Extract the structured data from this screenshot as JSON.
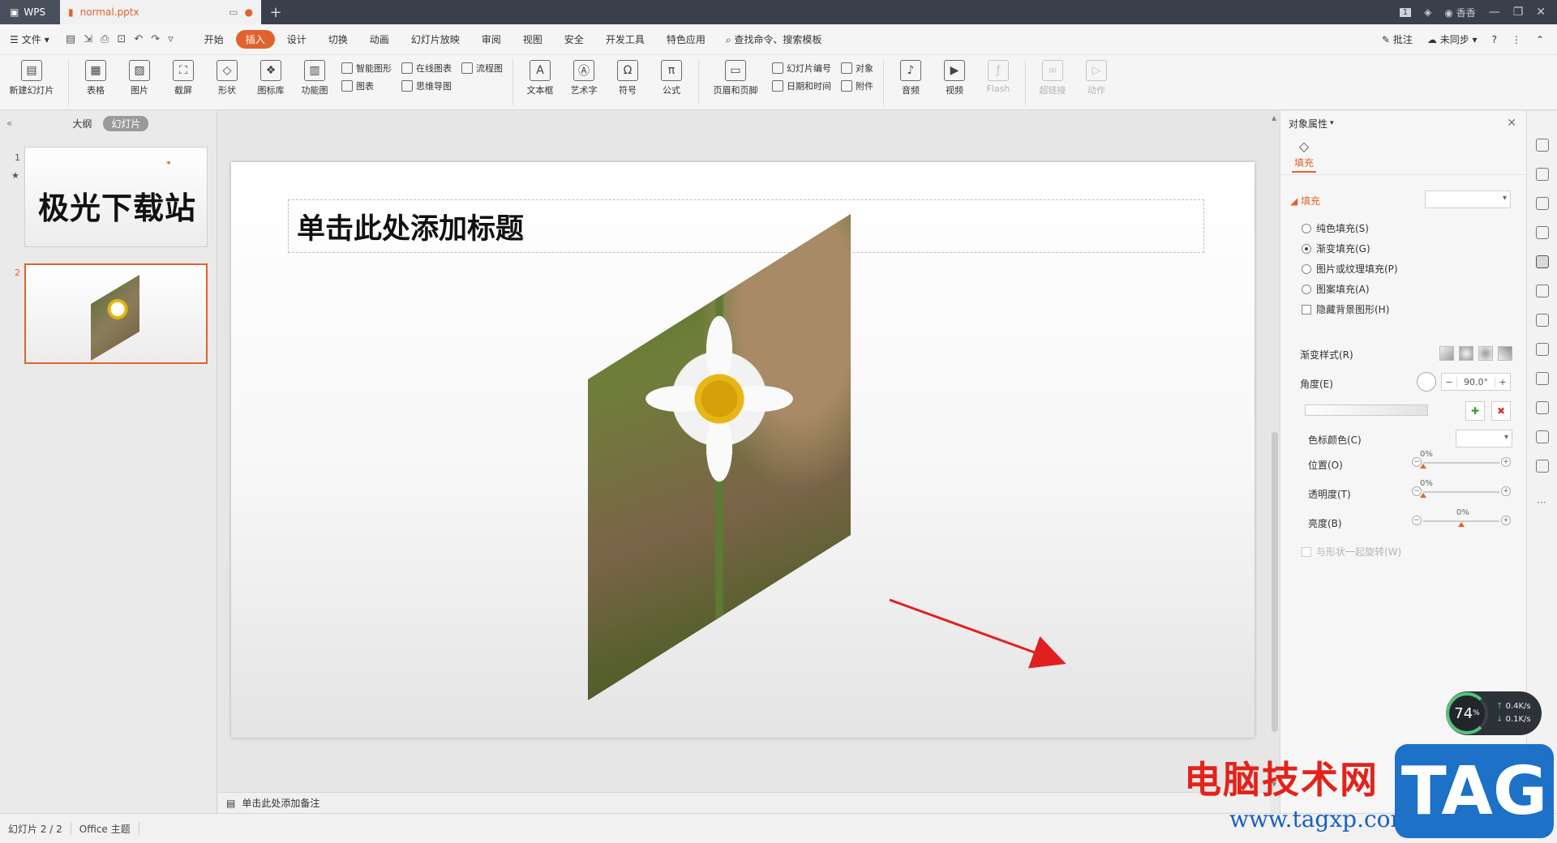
{
  "titlebar": {
    "app_label": "WPS",
    "doc_tab": "normal.pptx",
    "page_indicator": "1",
    "user": "香香"
  },
  "menubar": {
    "file": "文件",
    "items": [
      "开始",
      "插入",
      "设计",
      "切换",
      "动画",
      "幻灯片放映",
      "审阅",
      "视图",
      "安全",
      "开发工具",
      "特色应用"
    ],
    "active_item": "插入",
    "search": "查找命令、搜索模板",
    "annotate": "批注",
    "sync": "未同步",
    "help": "?"
  },
  "ribbon": {
    "new_slide": "新建幻灯片",
    "table": "表格",
    "picture": "图片",
    "screenshot": "截屏",
    "shape": "形状",
    "icon_lib": "图标库",
    "func_chart": "功能图",
    "smart_shape": "智能图形",
    "online_chart": "在线图表",
    "flowchart": "流程图",
    "chart": "图表",
    "mind_map": "思维导图",
    "textbox": "文本框",
    "art_text": "艺术字",
    "symbol": "符号",
    "formula": "公式",
    "header_footer": "页眉和页脚",
    "slide_number": "幻灯片编号",
    "object": "对象",
    "datetime": "日期和时间",
    "attachment": "附件",
    "audio": "音频",
    "video": "视频",
    "flash": "Flash",
    "hyperlink": "超链接",
    "action": "动作"
  },
  "leftpanel": {
    "tab_outline": "大纲",
    "tab_slides": "幻灯片",
    "slide1_number": "1",
    "slide1_text": "极光下载站",
    "slide2_number": "2"
  },
  "slide": {
    "title_placeholder": "单击此处添加标题"
  },
  "notes": {
    "placeholder": "单击此处添加备注"
  },
  "rightpanel": {
    "header": "对象属性",
    "tab_fill": "填充",
    "section_fill": "填充",
    "options": [
      "纯色填充(S)",
      "渐变填充(G)",
      "图片或纹理填充(P)",
      "图案填充(A)"
    ],
    "selected_option": "渐变填充(G)",
    "hide_bg": "隐藏背景图形(H)",
    "gradient_style": "渐变样式(R)",
    "angle_label": "角度(E)",
    "angle_value": "90.0°",
    "stop_color": "色标颜色(C)",
    "position_label": "位置(O)",
    "position_value": "0%",
    "transparency_label": "透明度(T)",
    "transparency_value": "0%",
    "brightness_label": "亮度(B)",
    "brightness_value": "0%",
    "rotate_with_shape": "与形状一起旋转(W)"
  },
  "statusbar": {
    "slide_info": "幻灯片 2 / 2",
    "theme": "Office 主题"
  },
  "speed_widget": {
    "percent": "74",
    "percent_unit": "%",
    "up_rate": "0.4",
    "down_rate": "0.1",
    "rate_unit": "K/s"
  },
  "watermark": {
    "cn_text": "电脑技术网",
    "url": "www.tagxp.com",
    "tag": "TAG"
  },
  "colors": {
    "accent": "#e0632e",
    "arrow": "#e02020",
    "watermark_red": "#e2231a",
    "watermark_blue": "#1d71c7"
  }
}
